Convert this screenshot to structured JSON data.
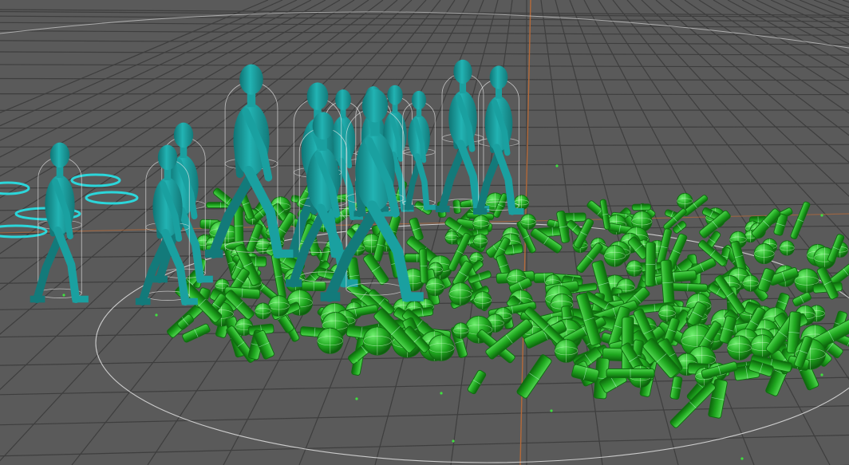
{
  "viewport": {
    "background_color": "#5a5a5a",
    "grid_color": "#4a4a4a",
    "grid_line_color": "#3e3e3e",
    "axis_color": "#b46a3a",
    "wireframe_color": "#e8e8e8",
    "glow_color": "#27e3e8"
  },
  "crowd": {
    "agent_color": "#1aa0a0",
    "agent_shade": "#137a7a",
    "agent_count": 14,
    "debris_color": "#1fa81f",
    "debris_dark": "#0f6e0f",
    "debris_light": "#5fe05f"
  }
}
